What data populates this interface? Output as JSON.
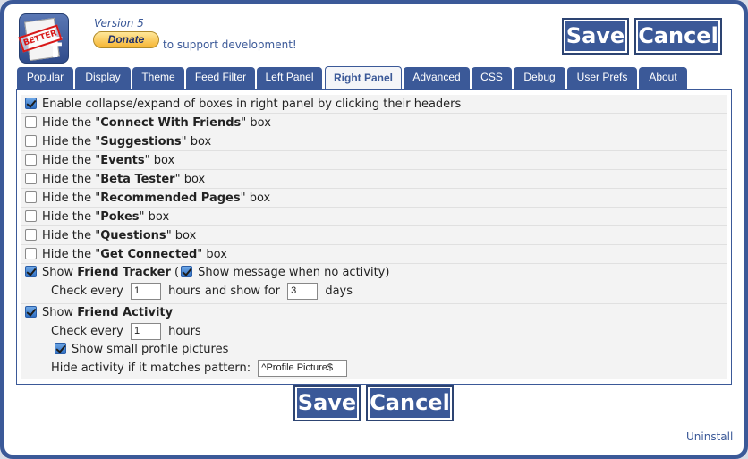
{
  "header": {
    "version": "Version 5",
    "donate_label": "Donate",
    "support_text": "to support development!",
    "logo_stamp": "BETTER"
  },
  "buttons": {
    "save": "Save",
    "cancel": "Cancel"
  },
  "tabs": [
    "Popular",
    "Display",
    "Theme",
    "Feed Filter",
    "Left Panel",
    "Right Panel",
    "Advanced",
    "CSS",
    "Debug",
    "User Prefs",
    "About"
  ],
  "active_tab": "Right Panel",
  "options": [
    {
      "pre": "Enable collapse/expand of boxes in right panel by clicking their headers",
      "bold": "",
      "post": "",
      "checked": true
    },
    {
      "pre": "Hide the \"",
      "bold": "Connect With Friends",
      "post": "\" box",
      "checked": false
    },
    {
      "pre": "Hide the \"",
      "bold": "Suggestions",
      "post": "\" box",
      "checked": false
    },
    {
      "pre": "Hide the \"",
      "bold": "Events",
      "post": "\" box",
      "checked": false
    },
    {
      "pre": "Hide the \"",
      "bold": "Beta Tester",
      "post": "\" box",
      "checked": false
    },
    {
      "pre": "Hide the \"",
      "bold": "Recommended Pages",
      "post": "\" box",
      "checked": false
    },
    {
      "pre": "Hide the \"",
      "bold": "Pokes",
      "post": "\" box",
      "checked": false
    },
    {
      "pre": "Hide the \"",
      "bold": "Questions",
      "post": "\" box",
      "checked": false
    },
    {
      "pre": "Hide the \"",
      "bold": "Get Connected",
      "post": "\" box",
      "checked": false
    }
  ],
  "friend_tracker": {
    "show": "Show",
    "bold": "Friend Tracker",
    "paren": "(",
    "no_activity_label": "Show message when no activity)",
    "check_every": "Check every",
    "hours_value": "1",
    "hours_and_show_for": "hours and show for",
    "days_value": "3",
    "days": "days",
    "checked": true,
    "no_activity_checked": true
  },
  "friend_activity": {
    "show": "Show",
    "bold": "Friend Activity",
    "check_every": "Check every",
    "hours_value": "1",
    "hours": "hours",
    "small_pics_label": "Show small profile pictures",
    "hide_pattern_label": "Hide activity if it matches pattern:",
    "pattern_value": "^Profile Picture$",
    "checked": true,
    "small_pics_checked": true
  },
  "footer": {
    "uninstall": "Uninstall"
  }
}
